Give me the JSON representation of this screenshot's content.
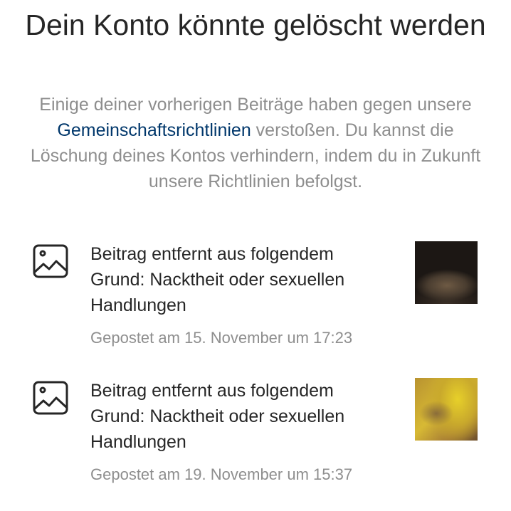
{
  "header": {
    "title": "Dein Konto könnte gelöscht werden"
  },
  "description": {
    "before_link": "Einige deiner vorherigen Beiträge haben gegen unsere ",
    "link": "Gemeinschaftsrichtlinien",
    "after_link": " verstoßen. Du kannst die Löschung deines Kontos verhindern, indem du in Zukunft unsere Richtlinien befolgst."
  },
  "posts": [
    {
      "icon": "image-icon",
      "reason": "Beitrag entfernt aus folgendem Grund: Nacktheit oder sexuellen Handlungen",
      "date": "Gepostet am 15. November um 17:23"
    },
    {
      "icon": "image-icon",
      "reason": "Beitrag entfernt aus folgendem Grund: Nacktheit oder sexuellen Handlungen",
      "date": "Gepostet am 19. November um 15:37"
    }
  ],
  "colors": {
    "text_primary": "#262626",
    "text_secondary": "#8e8e8e",
    "link": "#00376b"
  }
}
